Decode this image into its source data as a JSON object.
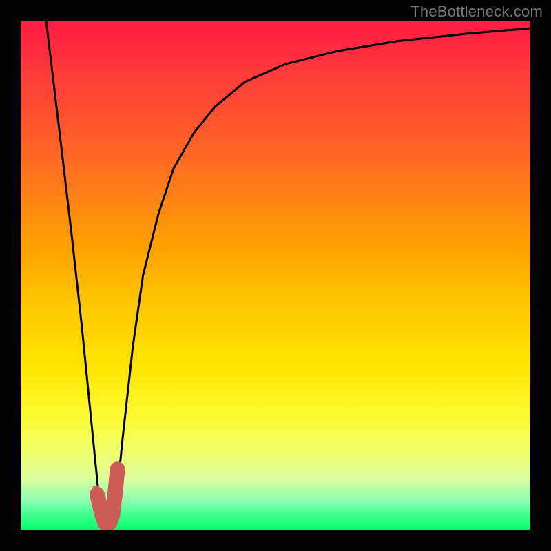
{
  "watermark": "TheBottleneck.com",
  "chart_data": {
    "type": "line",
    "title": "",
    "xlabel": "",
    "ylabel": "",
    "xlim": [
      0,
      100
    ],
    "ylim": [
      0,
      100
    ],
    "grid": false,
    "legend": false,
    "series": [
      {
        "name": "bottleneck-curve",
        "color": "#000000",
        "x": [
          5,
          8,
          10,
          12,
          14,
          15.5,
          17,
          18,
          19,
          20,
          22,
          24,
          27,
          30,
          34,
          38,
          44,
          52,
          62,
          74,
          88,
          100
        ],
        "values": [
          100,
          75,
          58,
          40,
          20,
          5,
          1,
          2,
          8,
          18,
          36,
          50,
          62,
          71,
          78,
          83,
          88,
          91.5,
          94,
          96,
          97.5,
          98.5
        ]
      },
      {
        "name": "highlight-segment",
        "color": "#cc5a55",
        "x": [
          15,
          15.5,
          16,
          16.5,
          17,
          17.5,
          18,
          18.5,
          19
        ],
        "values": [
          7,
          5,
          3,
          1.5,
          1,
          1.5,
          3,
          7,
          12
        ]
      }
    ],
    "highlight_point": {
      "x": 14.8,
      "y": 8,
      "color": "#cc5a55",
      "size": 12
    }
  }
}
